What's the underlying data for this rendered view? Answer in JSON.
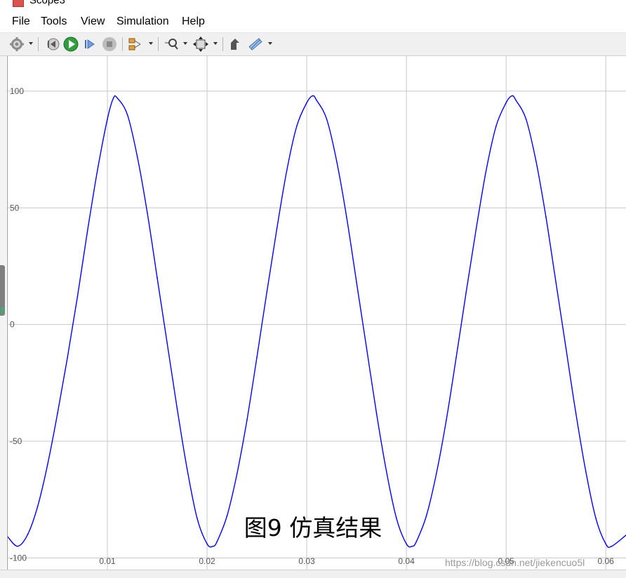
{
  "window": {
    "title": "Scope3"
  },
  "menu": {
    "items": [
      {
        "key": "File",
        "label": "File"
      },
      {
        "key": "Tools",
        "label": "Tools"
      },
      {
        "key": "View",
        "label": "View"
      },
      {
        "key": "Simulation",
        "label": "Simulation"
      },
      {
        "key": "Help",
        "label": "Help"
      }
    ]
  },
  "toolbar": {
    "icons": [
      "gear-icon",
      "step-back-icon",
      "run-icon",
      "step-forward-icon",
      "stop-icon",
      "signal-selector-icon",
      "zoom-icon",
      "fit-view-icon",
      "data-cursor-icon",
      "measurement-icon"
    ]
  },
  "caption": "图9  仿真结果",
  "watermark": "https://blog.csdn.net/jiekencuo5l",
  "colors": {
    "trace": "#0000ff",
    "grid": "#c8c8c8",
    "background": "#ffffff"
  },
  "chart_data": {
    "type": "line",
    "title": "",
    "xlabel": "",
    "ylabel": "",
    "xlim": [
      0,
      0.0621
    ],
    "ylim": [
      -105,
      115
    ],
    "grid": true,
    "x_ticks": [
      {
        "value": 0.01,
        "label": "0.01"
      },
      {
        "value": 0.02,
        "label": "0.02"
      },
      {
        "value": 0.03,
        "label": "0.03"
      },
      {
        "value": 0.04,
        "label": "0.04"
      },
      {
        "value": 0.05,
        "label": "0.05"
      },
      {
        "value": 0.06,
        "label": "0.06"
      }
    ],
    "y_ticks": [
      {
        "value": 100,
        "label": "100"
      },
      {
        "value": 50,
        "label": "50"
      },
      {
        "value": 0,
        "label": "0"
      },
      {
        "value": -50,
        "label": "-50"
      },
      {
        "value": -100,
        "label": "-100"
      }
    ],
    "series": [
      {
        "color": "#0000ff",
        "x": [
          0,
          0.001,
          0.002,
          0.003,
          0.004,
          0.005,
          0.006,
          0.007,
          0.008,
          0.009,
          0.01,
          0.0106,
          0.011,
          0.012,
          0.013,
          0.014,
          0.015,
          0.016,
          0.017,
          0.018,
          0.019,
          0.02,
          0.0206,
          0.021,
          0.022,
          0.023,
          0.024,
          0.025,
          0.026,
          0.027,
          0.028,
          0.029,
          0.03,
          0.0306,
          0.031,
          0.032,
          0.033,
          0.034,
          0.035,
          0.036,
          0.037,
          0.038,
          0.039,
          0.04,
          0.0406,
          0.041,
          0.042,
          0.043,
          0.044,
          0.045,
          0.046,
          0.047,
          0.048,
          0.049,
          0.05,
          0.0506,
          0.051,
          0.052,
          0.053,
          0.054,
          0.055,
          0.056,
          0.057,
          0.058,
          0.059,
          0.06,
          0.0606,
          0.0621
        ],
        "y": [
          -91,
          -95,
          -90,
          -78,
          -60,
          -38,
          -14,
          12,
          40,
          66,
          88,
          97,
          97,
          90,
          72,
          48,
          20,
          -8,
          -36,
          -62,
          -83,
          -94,
          -95,
          -93,
          -82,
          -64,
          -41,
          -14,
          14,
          41,
          66,
          85,
          95,
          98,
          96,
          88,
          70,
          46,
          18,
          -10,
          -38,
          -63,
          -83,
          -94,
          -95,
          -93,
          -82,
          -64,
          -41,
          -14,
          14,
          41,
          66,
          85,
          95,
          98,
          96,
          88,
          70,
          46,
          18,
          -10,
          -38,
          -63,
          -83,
          -94,
          -95,
          -90
        ]
      }
    ]
  }
}
